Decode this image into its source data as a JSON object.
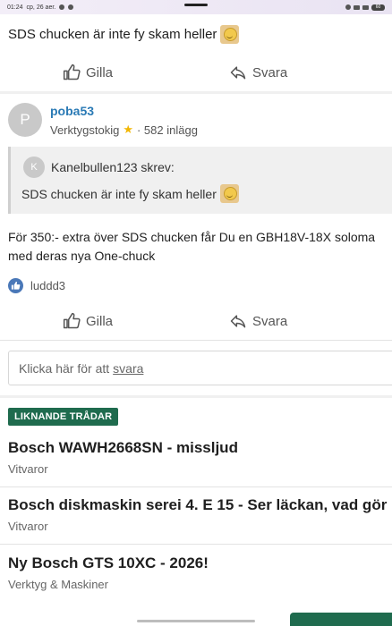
{
  "status_bar": {
    "time": "01:24",
    "date": "cp, 26 aer.",
    "battery": "60"
  },
  "top_post": {
    "text": "SDS chucken är inte fy skam heller"
  },
  "actions": {
    "like_label": "Gilla",
    "reply_label": "Svara"
  },
  "post": {
    "avatar_letter": "P",
    "username": "poba53",
    "rank": "Verktygstokig",
    "post_count": "· 582 inlägg",
    "quote": {
      "avatar_letter": "K",
      "author_line": "Kanelbullen123 skrev:",
      "text": "SDS chucken är inte fy skam heller"
    },
    "body_lines": [
      "För 350:- extra över SDS chucken får Du en GBH18V-18X soloma",
      "med deras nya One-chuck"
    ],
    "liked_by": "luddd3"
  },
  "reply_box": {
    "prefix": "Klicka här för att",
    "link": "svara"
  },
  "similar_threads": {
    "heading": "LIKNANDE TRÅDAR",
    "items": [
      {
        "title": "Bosch WAWH2668SN - missljud",
        "category": "Vitvaror"
      },
      {
        "title": "Bosch diskmaskin serei 4. E 15 - Ser läckan, vad gör",
        "category": "Vitvaror"
      },
      {
        "title": "Ny Bosch GTS 10XC - 2026!",
        "category": "Verktyg & Maskiner"
      }
    ]
  },
  "colors": {
    "accent": "#1f6b4e",
    "username": "#2a7ab5",
    "like_badge": "#4a78b8"
  }
}
